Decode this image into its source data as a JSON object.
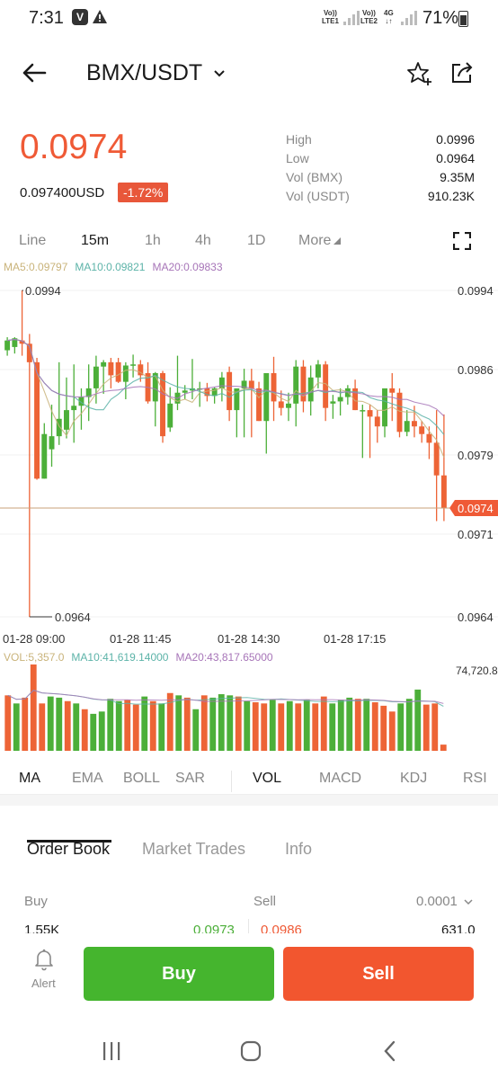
{
  "status_bar": {
    "time": "7:31",
    "badge": "V",
    "net1_top": "Vo))",
    "net1_bottom": "LTE1",
    "net2_top": "Vo))",
    "net2_bottom": "LTE2",
    "net3_top": "4G",
    "net3_bottom": "↓↑",
    "battery": "71%",
    "battery_level": 0.71
  },
  "header": {
    "pair": "BMX/USDT",
    "icons": [
      "back-arrow-icon",
      "chevron-down-icon",
      "star-plus-icon",
      "share-icon"
    ]
  },
  "ticker": {
    "last_price": "0.0974",
    "usd_price": "0.097400USD",
    "change": "-1.72%",
    "stats": [
      {
        "label": "High",
        "value": "0.0996"
      },
      {
        "label": "Low",
        "value": "0.0964"
      },
      {
        "label": "Vol (BMX)",
        "value": "9.35M"
      },
      {
        "label": "Vol (USDT)",
        "value": "910.23K"
      }
    ]
  },
  "timeframes": {
    "items": [
      "Line",
      "15m",
      "1h",
      "4h",
      "1D",
      "More"
    ],
    "active": "15m"
  },
  "ma_legend": {
    "ma5": "MA5:0.09797",
    "ma10": "MA10:0.09821",
    "ma20": "MA20:0.09833"
  },
  "colors": {
    "up": "#4caf39",
    "down": "#ed6436",
    "ma5": "#c9b37a",
    "ma10": "#5cb3a8",
    "ma20": "#a775b8",
    "accent": "#ef5a36"
  },
  "chart_data": {
    "type": "candlestick",
    "interval": "15m",
    "high_marker": "0.0994",
    "low_marker": "0.0964",
    "current_marker": "0.0974",
    "y_ticks": [
      "0.0994",
      "0.0986",
      "0.0979",
      "0.0971",
      "0.0964"
    ],
    "ylim": [
      0.0964,
      0.0994
    ],
    "x_ticks": [
      "01-28 09:00",
      "01-28 11:45",
      "01-28 14:30",
      "01-28 17:15"
    ],
    "candles": [
      {
        "o": 0.09885,
        "h": 0.09897,
        "l": 0.0988,
        "c": 0.09894
      },
      {
        "o": 0.09888,
        "h": 0.09897,
        "l": 0.09882,
        "c": 0.09896
      },
      {
        "o": 0.09894,
        "h": 0.0994,
        "l": 0.0988,
        "c": 0.09891
      },
      {
        "o": 0.09891,
        "h": 0.099,
        "l": 0.0964,
        "c": 0.09874
      },
      {
        "o": 0.09874,
        "h": 0.09878,
        "l": 0.09766,
        "c": 0.09767
      },
      {
        "o": 0.09767,
        "h": 0.09818,
        "l": 0.09767,
        "c": 0.09808
      },
      {
        "o": 0.09794,
        "h": 0.09835,
        "l": 0.09778,
        "c": 0.09806
      },
      {
        "o": 0.09806,
        "h": 0.09874,
        "l": 0.09798,
        "c": 0.09822
      },
      {
        "o": 0.09812,
        "h": 0.0986,
        "l": 0.09804,
        "c": 0.0983
      },
      {
        "o": 0.0983,
        "h": 0.09872,
        "l": 0.098,
        "c": 0.09834
      },
      {
        "o": 0.09834,
        "h": 0.0985,
        "l": 0.09812,
        "c": 0.09842
      },
      {
        "o": 0.09842,
        "h": 0.09872,
        "l": 0.0982,
        "c": 0.0985
      },
      {
        "o": 0.0985,
        "h": 0.0988,
        "l": 0.09836,
        "c": 0.0987
      },
      {
        "o": 0.0987,
        "h": 0.09876,
        "l": 0.09845,
        "c": 0.09874
      },
      {
        "o": 0.09874,
        "h": 0.09878,
        "l": 0.0985,
        "c": 0.09862
      },
      {
        "o": 0.09874,
        "h": 0.09878,
        "l": 0.09855,
        "c": 0.09856
      },
      {
        "o": 0.09856,
        "h": 0.09874,
        "l": 0.0984,
        "c": 0.09871
      },
      {
        "o": 0.09871,
        "h": 0.09881,
        "l": 0.0986,
        "c": 0.09872
      },
      {
        "o": 0.09872,
        "h": 0.09876,
        "l": 0.09856,
        "c": 0.09862
      },
      {
        "o": 0.09864,
        "h": 0.09874,
        "l": 0.09836,
        "c": 0.09838
      },
      {
        "o": 0.09838,
        "h": 0.09865,
        "l": 0.09815,
        "c": 0.09864
      },
      {
        "o": 0.09864,
        "h": 0.09866,
        "l": 0.098,
        "c": 0.09806
      },
      {
        "o": 0.09814,
        "h": 0.09851,
        "l": 0.0981,
        "c": 0.09836
      },
      {
        "o": 0.09836,
        "h": 0.0988,
        "l": 0.0983,
        "c": 0.09846
      },
      {
        "o": 0.09846,
        "h": 0.09853,
        "l": 0.0984,
        "c": 0.09848
      },
      {
        "o": 0.09848,
        "h": 0.09877,
        "l": 0.0984,
        "c": 0.0985
      },
      {
        "o": 0.0985,
        "h": 0.09856,
        "l": 0.09833,
        "c": 0.0985
      },
      {
        "o": 0.0985,
        "h": 0.09855,
        "l": 0.09838,
        "c": 0.09843
      },
      {
        "o": 0.09843,
        "h": 0.09851,
        "l": 0.09836,
        "c": 0.0985
      },
      {
        "o": 0.0985,
        "h": 0.09865,
        "l": 0.09838,
        "c": 0.0986
      },
      {
        "o": 0.09865,
        "h": 0.0987,
        "l": 0.0982,
        "c": 0.0983
      },
      {
        "o": 0.0983,
        "h": 0.09845,
        "l": 0.09805,
        "c": 0.0985
      },
      {
        "o": 0.0985,
        "h": 0.09868,
        "l": 0.09805,
        "c": 0.09857
      },
      {
        "o": 0.09857,
        "h": 0.09868,
        "l": 0.09805,
        "c": 0.0985
      },
      {
        "o": 0.0985,
        "h": 0.09856,
        "l": 0.0982,
        "c": 0.0982
      },
      {
        "o": 0.0982,
        "h": 0.09862,
        "l": 0.0979,
        "c": 0.09864
      },
      {
        "o": 0.09864,
        "h": 0.09879,
        "l": 0.0982,
        "c": 0.09838
      },
      {
        "o": 0.09838,
        "h": 0.09848,
        "l": 0.09825,
        "c": 0.09832
      },
      {
        "o": 0.09832,
        "h": 0.09846,
        "l": 0.0982,
        "c": 0.09836
      },
      {
        "o": 0.09836,
        "h": 0.09876,
        "l": 0.09815,
        "c": 0.0987
      },
      {
        "o": 0.0987,
        "h": 0.09876,
        "l": 0.09828,
        "c": 0.09838
      },
      {
        "o": 0.09838,
        "h": 0.09871,
        "l": 0.09825,
        "c": 0.0986
      },
      {
        "o": 0.0986,
        "h": 0.09876,
        "l": 0.0985,
        "c": 0.09872
      },
      {
        "o": 0.09872,
        "h": 0.09875,
        "l": 0.0982,
        "c": 0.09832
      },
      {
        "o": 0.09836,
        "h": 0.09844,
        "l": 0.09822,
        "c": 0.09838
      },
      {
        "o": 0.09838,
        "h": 0.0985,
        "l": 0.09825,
        "c": 0.09842
      },
      {
        "o": 0.09842,
        "h": 0.09853,
        "l": 0.09835,
        "c": 0.0985
      },
      {
        "o": 0.0985,
        "h": 0.09858,
        "l": 0.0983,
        "c": 0.0983
      },
      {
        "o": 0.0983,
        "h": 0.09835,
        "l": 0.09786,
        "c": 0.0983
      },
      {
        "o": 0.0983,
        "h": 0.09835,
        "l": 0.09786,
        "c": 0.09824
      },
      {
        "o": 0.09824,
        "h": 0.0983,
        "l": 0.098,
        "c": 0.09815
      },
      {
        "o": 0.09815,
        "h": 0.0983,
        "l": 0.09805,
        "c": 0.0985
      },
      {
        "o": 0.0985,
        "h": 0.09864,
        "l": 0.0982,
        "c": 0.09846
      },
      {
        "o": 0.09846,
        "h": 0.0985,
        "l": 0.09805,
        "c": 0.0981
      },
      {
        "o": 0.0981,
        "h": 0.0983,
        "l": 0.09806,
        "c": 0.0982
      },
      {
        "o": 0.0982,
        "h": 0.09834,
        "l": 0.09805,
        "c": 0.09815
      },
      {
        "o": 0.09815,
        "h": 0.0982,
        "l": 0.098,
        "c": 0.09808
      },
      {
        "o": 0.09808,
        "h": 0.09815,
        "l": 0.09785,
        "c": 0.098
      },
      {
        "o": 0.098,
        "h": 0.0983,
        "l": 0.09728,
        "c": 0.0977
      },
      {
        "o": 0.0977,
        "h": 0.09826,
        "l": 0.09728,
        "c": 0.0974
      }
    ]
  },
  "volume_legend": {
    "vol": "VOL:5,357.0",
    "ma10": "MA10:41,619.14000",
    "ma20": "MA20:43,817.65000",
    "max": "74,720.8"
  },
  "volume_data": [
    {
      "v": 48000,
      "up": false
    },
    {
      "v": 41000,
      "up": true
    },
    {
      "v": 46000,
      "up": false
    },
    {
      "v": 74720,
      "up": false
    },
    {
      "v": 41000,
      "up": false
    },
    {
      "v": 47000,
      "up": true
    },
    {
      "v": 46000,
      "up": true
    },
    {
      "v": 43000,
      "up": false
    },
    {
      "v": 41000,
      "up": true
    },
    {
      "v": 36000,
      "up": false
    },
    {
      "v": 32000,
      "up": true
    },
    {
      "v": 34000,
      "up": true
    },
    {
      "v": 45000,
      "up": true
    },
    {
      "v": 43000,
      "up": true
    },
    {
      "v": 44000,
      "up": false
    },
    {
      "v": 40000,
      "up": false
    },
    {
      "v": 47000,
      "up": true
    },
    {
      "v": 43000,
      "up": false
    },
    {
      "v": 41000,
      "up": true
    },
    {
      "v": 50000,
      "up": false
    },
    {
      "v": 48000,
      "up": true
    },
    {
      "v": 46000,
      "up": false
    },
    {
      "v": 36000,
      "up": true
    },
    {
      "v": 48000,
      "up": false
    },
    {
      "v": 46000,
      "up": true
    },
    {
      "v": 49000,
      "up": true
    },
    {
      "v": 48000,
      "up": true
    },
    {
      "v": 47000,
      "up": false
    },
    {
      "v": 43000,
      "up": true
    },
    {
      "v": 42000,
      "up": false
    },
    {
      "v": 41000,
      "up": false
    },
    {
      "v": 44000,
      "up": true
    },
    {
      "v": 41000,
      "up": false
    },
    {
      "v": 43000,
      "up": true
    },
    {
      "v": 41000,
      "up": false
    },
    {
      "v": 44000,
      "up": true
    },
    {
      "v": 41000,
      "up": false
    },
    {
      "v": 47000,
      "up": false
    },
    {
      "v": 41000,
      "up": true
    },
    {
      "v": 44000,
      "up": true
    },
    {
      "v": 46000,
      "up": true
    },
    {
      "v": 45000,
      "up": false
    },
    {
      "v": 45000,
      "up": true
    },
    {
      "v": 42000,
      "up": false
    },
    {
      "v": 39000,
      "up": false
    },
    {
      "v": 34000,
      "up": false
    },
    {
      "v": 41000,
      "up": true
    },
    {
      "v": 45000,
      "up": true
    },
    {
      "v": 53000,
      "up": true
    },
    {
      "v": 40000,
      "up": false
    },
    {
      "v": 41000,
      "up": false
    },
    {
      "v": 5357,
      "up": false
    }
  ],
  "indicators": {
    "left": [
      "MA",
      "EMA",
      "BOLL",
      "SAR"
    ],
    "right": [
      "VOL",
      "MACD",
      "KDJ",
      "RSI"
    ],
    "active_left": "MA",
    "active_right": "VOL"
  },
  "tabs": {
    "items": [
      "Order Book",
      "Market Trades",
      "Info"
    ],
    "active": "Order Book"
  },
  "order_book": {
    "buy_label": "Buy",
    "sell_label": "Sell",
    "precision": "0.0001",
    "first_row": {
      "buy_qty": "1.55K",
      "buy_price": "0.0973",
      "sell_price": "0.0986",
      "sell_qty": "631.0"
    }
  },
  "actions": {
    "alert": "Alert",
    "buy": "Buy",
    "sell": "Sell"
  },
  "nav": {
    "icons": [
      "recents-icon",
      "home-icon",
      "back-icon"
    ]
  }
}
